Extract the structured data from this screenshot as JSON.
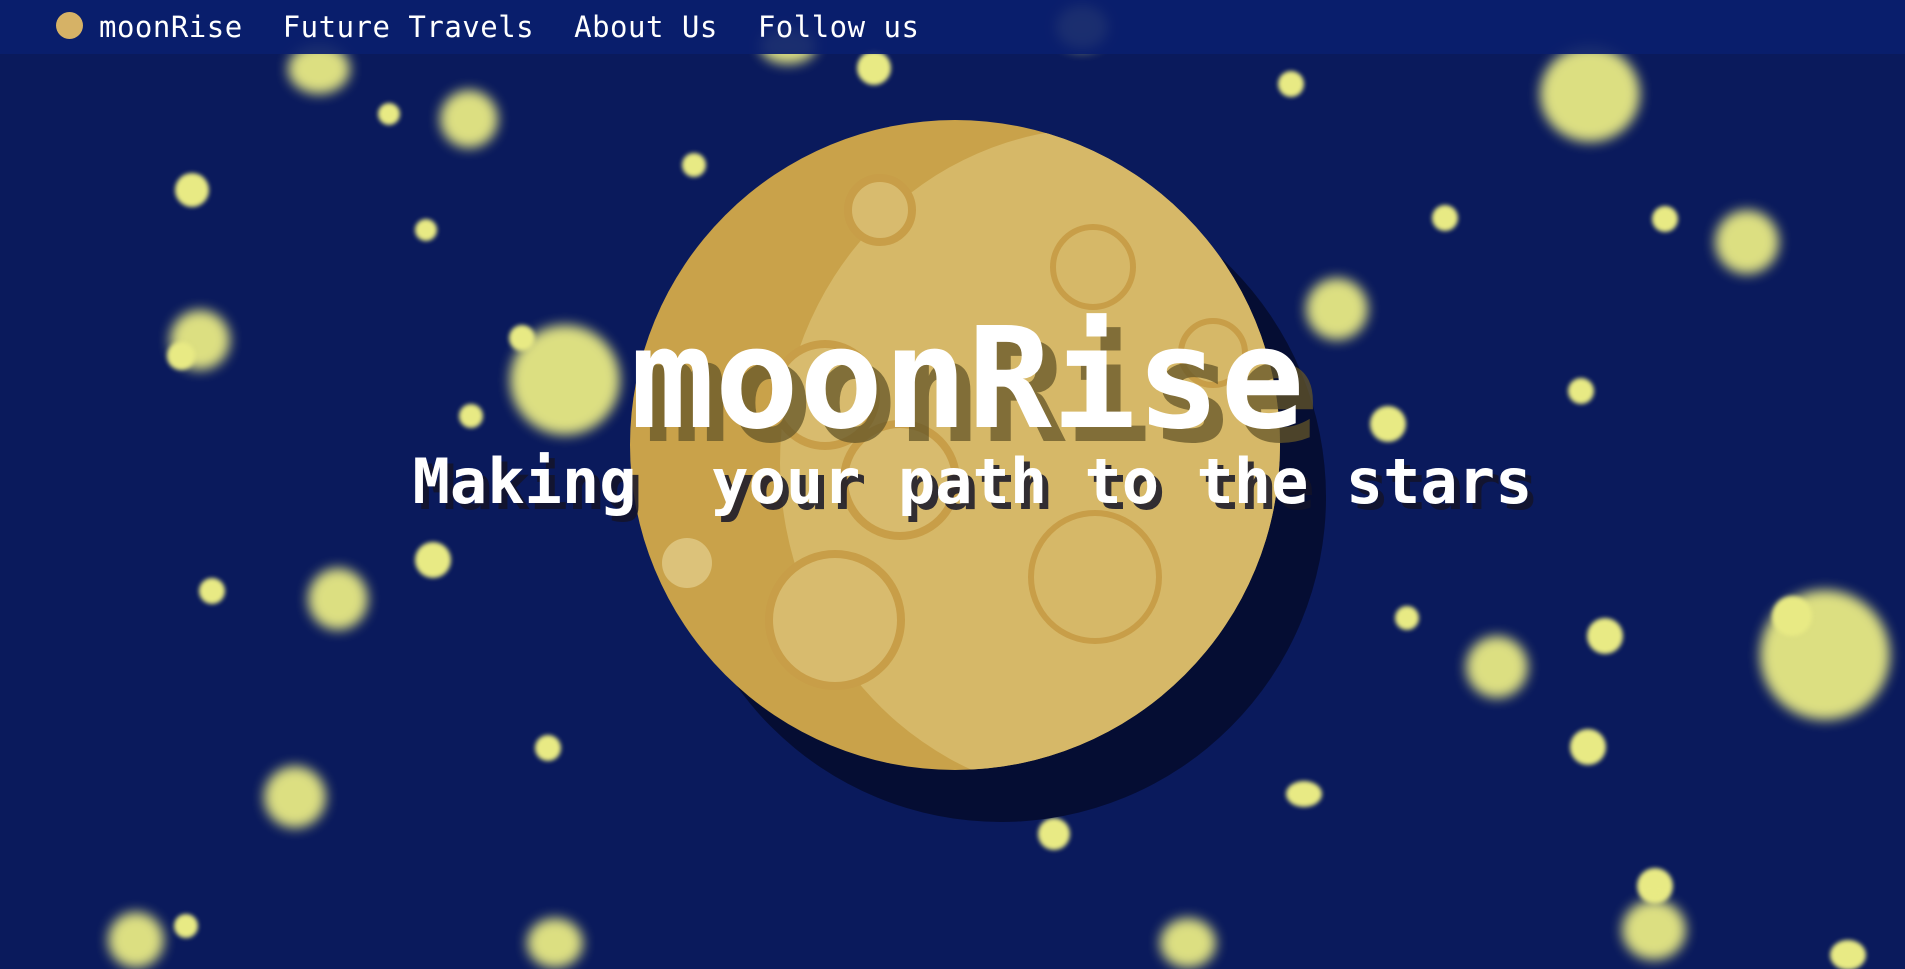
{
  "nav": {
    "logo_icon": "moon-logo-icon",
    "items": [
      {
        "label": "moonRise"
      },
      {
        "label": "Future Travels"
      },
      {
        "label": "About Us"
      },
      {
        "label": "Follow us"
      }
    ]
  },
  "hero": {
    "title": "moonRise",
    "subtitle": "Making  your path to the stars"
  },
  "colors": {
    "background": "#0a1a5c",
    "navbar": "#0b1e6e",
    "moon_dark": "#c9a24a",
    "moon_light": "#d6b868",
    "star": "#e8ea84"
  }
}
